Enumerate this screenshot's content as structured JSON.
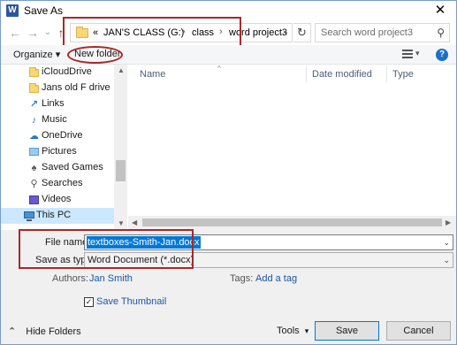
{
  "window": {
    "title": "Save As",
    "app_icon_letter": "W",
    "close_glyph": "✕"
  },
  "nav_buttons": {
    "back_glyph": "←",
    "forward_glyph": "→",
    "recent_glyph": "⌄",
    "up_glyph": "↑"
  },
  "address": {
    "overflow": "«",
    "crumbs": [
      "JAN'S CLASS (G:)",
      "class",
      "word project3"
    ],
    "separator": "›",
    "dropdown_glyph": "⌄",
    "refresh_glyph": "↻"
  },
  "search": {
    "placeholder": "Search word project3",
    "icon_glyph": "⚲"
  },
  "toolbar": {
    "organize_label": "Organize ▾",
    "new_folder_label": "New folder",
    "view_dropdown_glyph": "▾",
    "help_glyph": "?"
  },
  "nav_pane": {
    "items": [
      {
        "label": "iCloudDrive",
        "icon": "folder-icon"
      },
      {
        "label": "Jans old F drive",
        "icon": "folder-icon"
      },
      {
        "label": "Links",
        "icon": "links-icon"
      },
      {
        "label": "Music",
        "icon": "music-icon"
      },
      {
        "label": "OneDrive",
        "icon": "onedrive-icon"
      },
      {
        "label": "Pictures",
        "icon": "pictures-icon"
      },
      {
        "label": "Saved Games",
        "icon": "saved-games-icon"
      },
      {
        "label": "Searches",
        "icon": "searches-icon"
      },
      {
        "label": "Videos",
        "icon": "videos-icon"
      },
      {
        "label": "This PC",
        "icon": "this-pc-icon",
        "selected": true
      }
    ]
  },
  "file_list": {
    "columns": [
      "Name",
      "Date modified",
      "Type"
    ],
    "sort_glyph": "^"
  },
  "form": {
    "file_name_label": "File name:",
    "file_name_value": "textboxes-Smith-Jan.docx",
    "save_type_label": "Save as type:",
    "save_type_value": "Word Document (*.docx)",
    "dropdown_glyph": "⌄",
    "authors_label": "Authors:",
    "authors_value": "Jan Smith",
    "tags_label": "Tags:",
    "tags_value": "Add a tag",
    "thumbnail_label": "Save Thumbnail",
    "thumbnail_checked_glyph": "✓"
  },
  "footer": {
    "hide_folders_label": "Hide Folders",
    "hide_folders_glyph": "⌃",
    "tools_label": "Tools",
    "tools_glyph": "▾",
    "save_label": "Save",
    "cancel_label": "Cancel"
  },
  "colors": {
    "annotation_red": "#a52a2a",
    "selection_blue": "#0078d7",
    "folder_yellow": "#f8d775"
  }
}
